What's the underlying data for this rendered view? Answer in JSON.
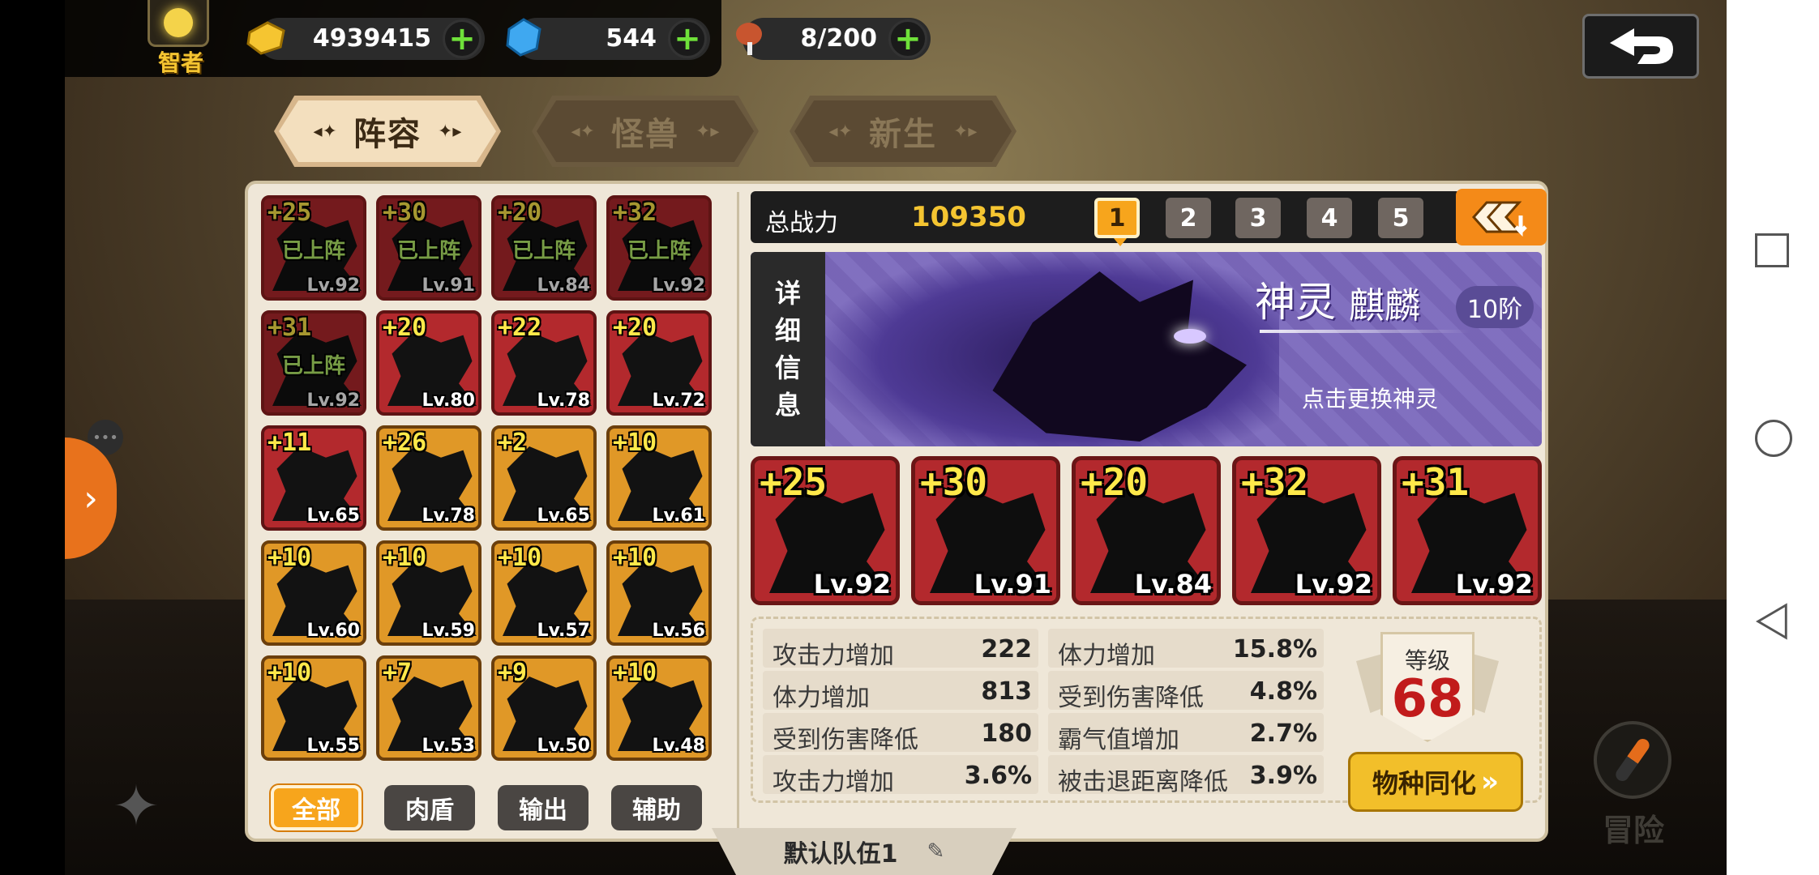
{
  "player": {
    "rank": "智者",
    "icon": "lightbulb-icon"
  },
  "resources": {
    "gold": {
      "value": "4939415",
      "icon": "gold-coin-icon"
    },
    "gem": {
      "value": "544",
      "icon": "gem-icon"
    },
    "food": {
      "value": "8/200",
      "icon": "meat-icon"
    }
  },
  "tabs": [
    {
      "label": "阵容",
      "active": true
    },
    {
      "label": "怪兽",
      "active": false
    },
    {
      "label": "新生",
      "active": false
    }
  ],
  "roster": [
    {
      "plus": "+25",
      "level": "Lv.92",
      "deployed": "已上阵",
      "color": "red"
    },
    {
      "plus": "+30",
      "level": "Lv.91",
      "deployed": "已上阵",
      "color": "red"
    },
    {
      "plus": "+20",
      "level": "Lv.84",
      "deployed": "已上阵",
      "color": "red"
    },
    {
      "plus": "+32",
      "level": "Lv.92",
      "deployed": "已上阵",
      "color": "red"
    },
    {
      "plus": "+31",
      "level": "Lv.92",
      "deployed": "已上阵",
      "color": "red"
    },
    {
      "plus": "+20",
      "level": "Lv.80",
      "deployed": "",
      "color": "red"
    },
    {
      "plus": "+22",
      "level": "Lv.78",
      "deployed": "",
      "color": "red"
    },
    {
      "plus": "+20",
      "level": "Lv.72",
      "deployed": "",
      "color": "red"
    },
    {
      "plus": "+11",
      "level": "Lv.65",
      "deployed": "",
      "color": "red"
    },
    {
      "plus": "+26",
      "level": "Lv.78",
      "deployed": "",
      "color": "orange"
    },
    {
      "plus": "+2",
      "level": "Lv.65",
      "deployed": "",
      "color": "orange"
    },
    {
      "plus": "+10",
      "level": "Lv.61",
      "deployed": "",
      "color": "orange"
    },
    {
      "plus": "+10",
      "level": "Lv.60",
      "deployed": "",
      "color": "orange"
    },
    {
      "plus": "+10",
      "level": "Lv.59",
      "deployed": "",
      "color": "orange"
    },
    {
      "plus": "+10",
      "level": "Lv.57",
      "deployed": "",
      "color": "orange"
    },
    {
      "plus": "+10",
      "level": "Lv.56",
      "deployed": "",
      "color": "orange"
    },
    {
      "plus": "+10",
      "level": "Lv.55",
      "deployed": "",
      "color": "orange"
    },
    {
      "plus": "+7",
      "level": "Lv.53",
      "deployed": "",
      "color": "orange"
    },
    {
      "plus": "+9",
      "level": "Lv.50",
      "deployed": "",
      "color": "orange"
    },
    {
      "plus": "+10",
      "level": "Lv.48",
      "deployed": "",
      "color": "orange"
    }
  ],
  "filters": [
    {
      "label": "全部",
      "active": true
    },
    {
      "label": "肉盾",
      "active": false
    },
    {
      "label": "输出",
      "active": false
    },
    {
      "label": "辅助",
      "active": false
    }
  ],
  "power": {
    "label": "总战力",
    "value": "109350"
  },
  "team_slots": [
    {
      "label": "1",
      "active": true
    },
    {
      "label": "2",
      "active": false
    },
    {
      "label": "3",
      "active": false
    },
    {
      "label": "4",
      "active": false
    },
    {
      "label": "5",
      "active": false
    }
  ],
  "god": {
    "detail_label": [
      "详",
      "细",
      "信",
      "息"
    ],
    "type": "神灵",
    "name": "麒麟",
    "stage": "10阶",
    "hint": "点击更换神灵"
  },
  "team_members": [
    {
      "plus": "+25",
      "level": "Lv.92"
    },
    {
      "plus": "+30",
      "level": "Lv.91"
    },
    {
      "plus": "+20",
      "level": "Lv.84"
    },
    {
      "plus": "+32",
      "level": "Lv.92"
    },
    {
      "plus": "+31",
      "level": "Lv.92"
    }
  ],
  "stats_left": [
    {
      "name": "攻击力增加",
      "value": "222"
    },
    {
      "name": "体力增加",
      "value": "813"
    },
    {
      "name": "受到伤害降低",
      "value": "180"
    },
    {
      "name": "攻击力增加",
      "value": "3.6%"
    }
  ],
  "stats_right": [
    {
      "name": "体力增加",
      "value": "15.8%"
    },
    {
      "name": "受到伤害降低",
      "value": "4.8%"
    },
    {
      "name": "霸气值增加",
      "value": "2.7%"
    },
    {
      "name": "被击退距离降低",
      "value": "3.9%"
    }
  ],
  "level": {
    "label": "等级",
    "value": "68"
  },
  "evolve_label": "物种同化",
  "team_name": "默认队伍1",
  "adventure_label": "冒险",
  "colors": {
    "accent": "#f7a51c",
    "red_card": "#b3292d",
    "orange_card": "#e09827",
    "god_banner": "#7b68ba"
  }
}
